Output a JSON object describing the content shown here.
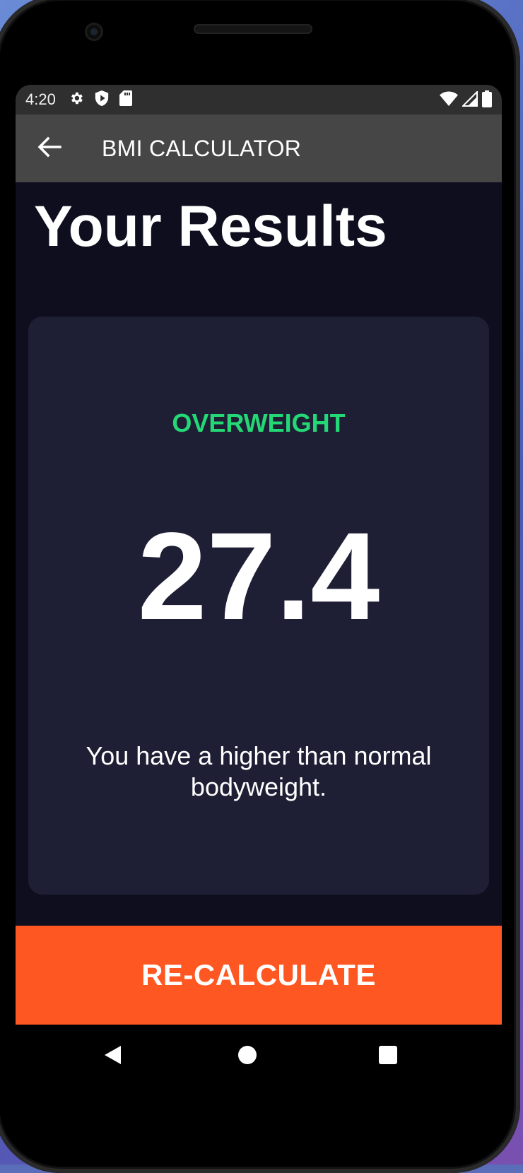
{
  "status_bar": {
    "time": "4:20",
    "left_icons": [
      "settings-icon",
      "shield-icon",
      "sd-card-icon"
    ],
    "right_icons": [
      "wifi-icon",
      "signal-icon",
      "battery-icon"
    ]
  },
  "app_bar": {
    "title": "BMI CALCULATOR",
    "back_icon": "arrow-back-icon"
  },
  "page": {
    "title": "Your Results"
  },
  "result": {
    "category": "OVERWEIGHT",
    "bmi": "27.4",
    "interpretation": "You have a higher than normal bodyweight.",
    "category_color": "#24d876"
  },
  "action": {
    "recalculate_label": "RE-CALCULATE",
    "button_color": "#ff5722"
  },
  "nav_bar": {
    "buttons": [
      "back-triangle-icon",
      "home-circle-icon",
      "recents-square-icon"
    ]
  }
}
